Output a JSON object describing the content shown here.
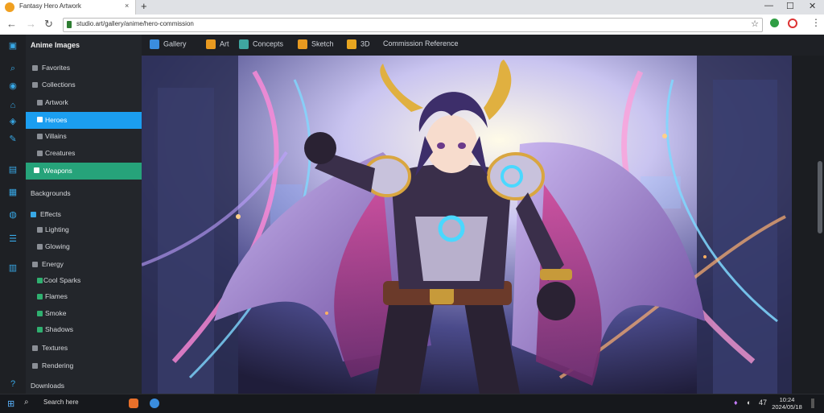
{
  "browser": {
    "tab_title": "Fantasy Hero Artwork",
    "tab_close": "×",
    "new_tab": "+",
    "url": "studio.art/gallery/anime/hero-commission",
    "window_controls": [
      "—",
      "☐",
      "✕"
    ]
  },
  "bookmarks": [
    {
      "label": "Gallery",
      "color": "#3a8dde"
    },
    {
      "label": "Art",
      "color": "#e89a20"
    },
    {
      "label": "Concepts",
      "color": "#3fa6a0"
    },
    {
      "label": "Sketch",
      "color": "#e89a20"
    },
    {
      "label": "3D",
      "color": "#e8a620"
    },
    {
      "label": "Commission Reference",
      "color": ""
    }
  ],
  "sidebar": {
    "title": "Anime Images",
    "items": [
      {
        "label": "Favorites",
        "state": "normal"
      },
      {
        "label": "Collections",
        "state": "normal"
      },
      {
        "label": "Artwork",
        "state": "normal"
      },
      {
        "label": "Heroes",
        "state": "active-blue"
      },
      {
        "label": "Villains",
        "state": "normal"
      },
      {
        "label": "Creatures",
        "state": "normal"
      },
      {
        "label": "Weapons",
        "state": "active-green"
      },
      {
        "label": "Backgrounds",
        "state": "section"
      },
      {
        "label": "Effects",
        "state": "section"
      },
      {
        "label": "Lighting",
        "state": "normal"
      },
      {
        "label": "Glowing",
        "state": "normal"
      },
      {
        "label": "Energy",
        "state": "normal"
      },
      {
        "label": "Cool Sparks",
        "state": "green"
      },
      {
        "label": "Flames",
        "state": "green"
      },
      {
        "label": "Smoke",
        "state": "green"
      },
      {
        "label": "Shadows",
        "state": "green"
      },
      {
        "label": "Textures",
        "state": "normal"
      },
      {
        "label": "Rendering",
        "state": "normal"
      },
      {
        "label": "Downloads",
        "state": "section"
      }
    ]
  },
  "taskbar": {
    "search_label": "Search here",
    "clock_time": "10:24",
    "clock_date": "2024/05/18",
    "tray_label": "47"
  },
  "colors": {
    "accent_blue": "#1b9ef0",
    "accent_green": "#26a37a",
    "rail_icon": "#38a8e6"
  }
}
